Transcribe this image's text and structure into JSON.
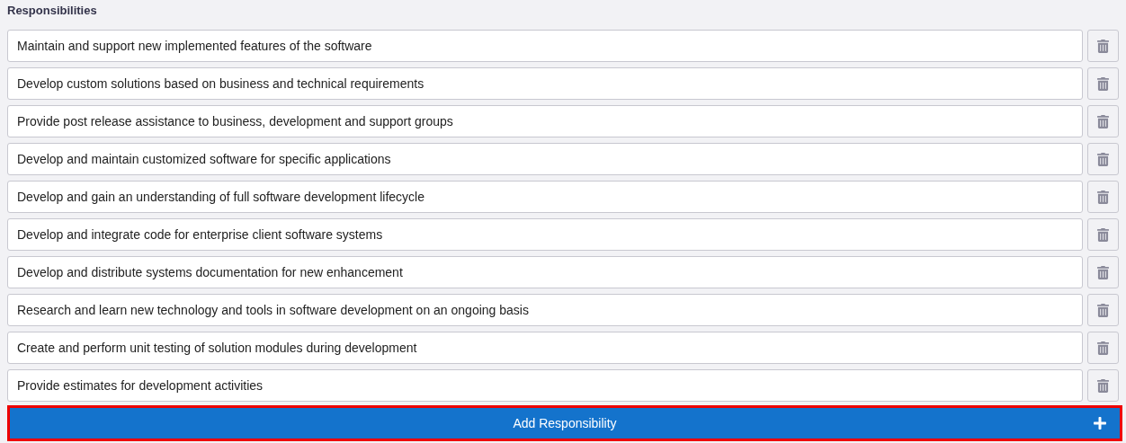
{
  "section_title": "Responsibilities",
  "responsibilities": [
    {
      "value": "Maintain and support new implemented features of the software"
    },
    {
      "value": "Develop custom solutions based on business and technical requirements"
    },
    {
      "value": "Provide post release assistance to business, development and support groups"
    },
    {
      "value": "Develop and maintain customized software for specific applications"
    },
    {
      "value": "Develop and gain an understanding of full software development lifecycle"
    },
    {
      "value": "Develop and integrate code for enterprise client software systems"
    },
    {
      "value": "Develop and distribute systems documentation for new enhancement"
    },
    {
      "value": "Research and learn new technology and tools in software development on an ongoing basis"
    },
    {
      "value": "Create and perform unit testing of solution modules during development"
    },
    {
      "value": "Provide estimates for development activities"
    }
  ],
  "add_button": {
    "label": "Add Responsibility",
    "highlighted": true
  }
}
